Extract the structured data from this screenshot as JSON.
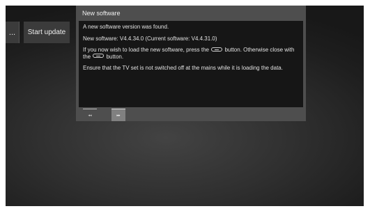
{
  "menu": {
    "more_label": "...",
    "start_update_label": "Start update"
  },
  "dialog": {
    "title": "New software",
    "line1": "A new software version was found.",
    "line2": "New software:  V4.4.34.0   (Current software:  V4.4.31.0)",
    "line3_a": "If you now wish to load the new software, press the",
    "line3_b": "button. Otherwise close with the",
    "line3_c": "button.",
    "line4": "Ensure that the TV set is not switched off at the mains while it is loading the data."
  },
  "nav": {
    "prev_glyph": "◂◂",
    "next_glyph": "▸▸"
  }
}
